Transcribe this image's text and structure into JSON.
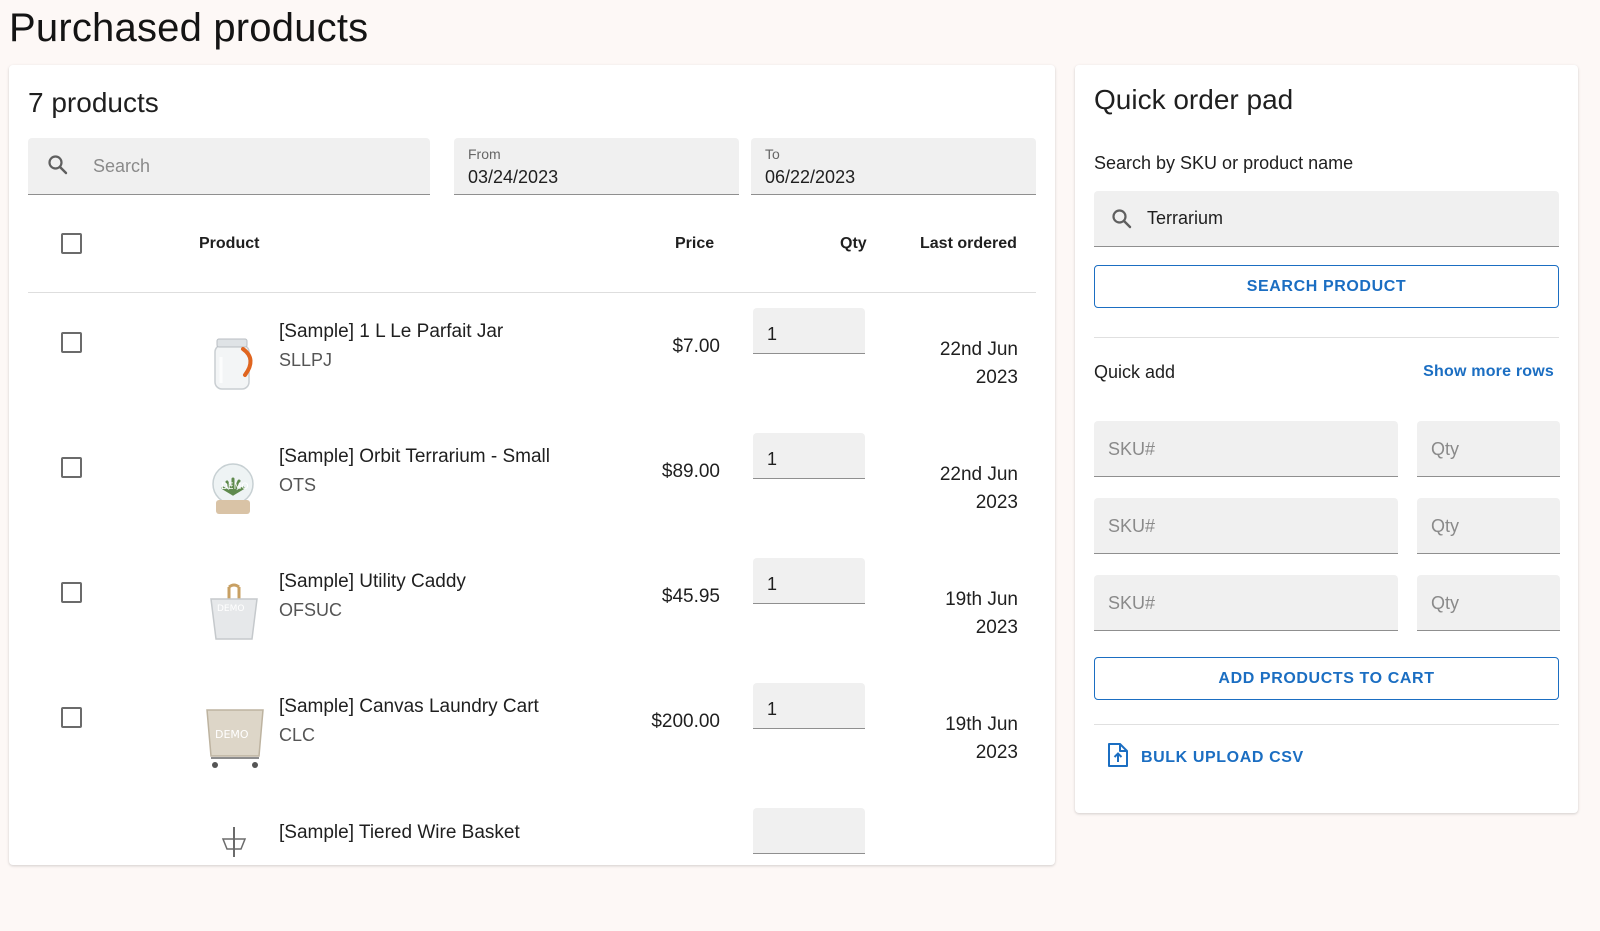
{
  "page": {
    "title": "Purchased products"
  },
  "products_panel": {
    "count_label": "7 products",
    "search": {
      "placeholder": "Search"
    },
    "from": {
      "label": "From",
      "value": "03/24/2023"
    },
    "to": {
      "label": "To",
      "value": "06/22/2023"
    },
    "headers": {
      "product": "Product",
      "price": "Price",
      "qty": "Qty",
      "last_ordered": "Last ordered"
    },
    "rows": [
      {
        "name": "[Sample] 1 L Le Parfait Jar",
        "sku": "SLLPJ",
        "price": "$7.00",
        "qty": "1",
        "last_day": "22nd Jun",
        "last_year": "2023",
        "thumb": "jar-thumbnail"
      },
      {
        "name": "[Sample] Orbit Terrarium - Small",
        "sku": "OTS",
        "price": "$89.00",
        "qty": "1",
        "last_day": "22nd Jun",
        "last_year": "2023",
        "thumb": "terrarium-thumbnail"
      },
      {
        "name": "[Sample] Utility Caddy",
        "sku": "OFSUC",
        "price": "$45.95",
        "qty": "1",
        "last_day": "19th Jun",
        "last_year": "2023",
        "thumb": "caddy-thumbnail"
      },
      {
        "name": "[Sample] Canvas Laundry Cart",
        "sku": "CLC",
        "price": "$200.00",
        "qty": "1",
        "last_day": "19th Jun",
        "last_year": "2023",
        "thumb": "laundry-cart-thumbnail"
      },
      {
        "name": "[Sample] Tiered Wire Basket",
        "sku": "",
        "price": "",
        "qty": "",
        "last_day": "",
        "last_year": "",
        "thumb": "wire-basket-thumbnail"
      }
    ]
  },
  "quick_order": {
    "title": "Quick order pad",
    "search_label": "Search by SKU or product name",
    "search_value": "Terrarium",
    "search_button": "SEARCH PRODUCT",
    "quick_add_label": "Quick add",
    "show_more": "Show more rows",
    "sku_placeholder": "SKU#",
    "qty_placeholder": "Qty",
    "add_button": "ADD PRODUCTS TO CART",
    "bulk_upload": "BULK UPLOAD CSV"
  },
  "colors": {
    "accent": "#1b6ec2",
    "background": "#fdf8f6",
    "field": "#f0f0f0"
  }
}
